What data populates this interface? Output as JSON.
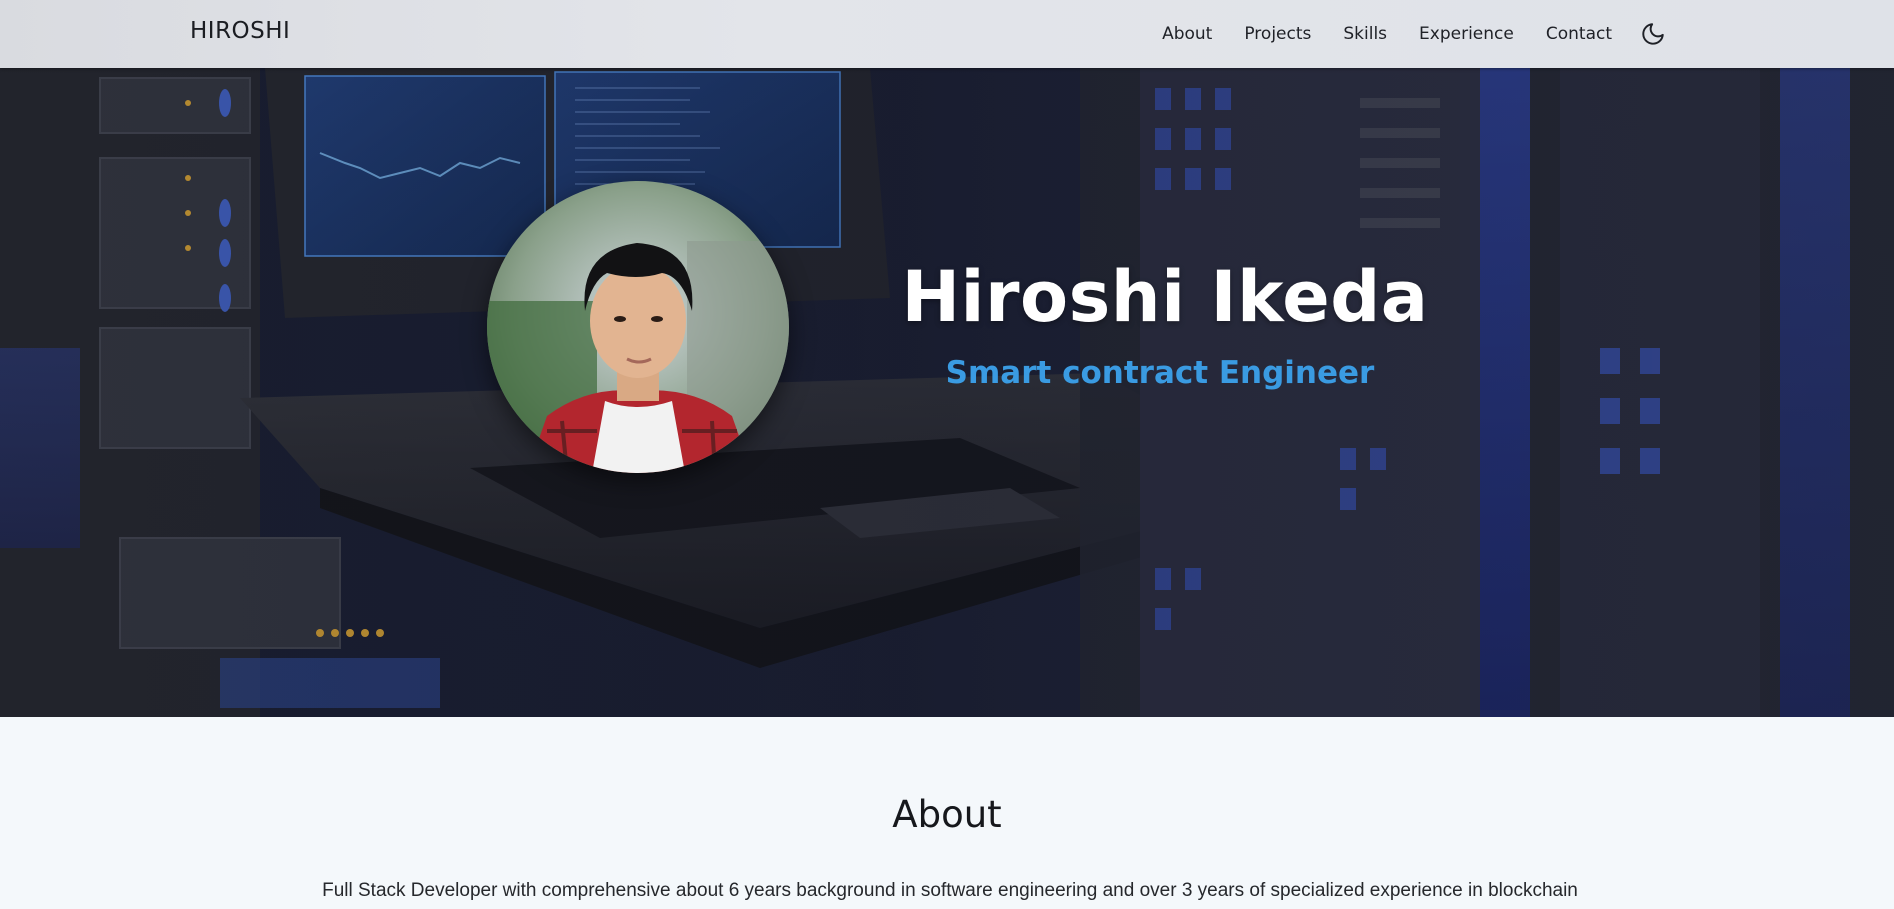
{
  "nav": {
    "brand": "HIROSHI",
    "links": [
      "About",
      "Projects",
      "Skills",
      "Experience",
      "Contact"
    ],
    "theme_toggle_icon": "moon-icon"
  },
  "hero": {
    "name": "Hiroshi Ikeda",
    "role": "Smart contract Engineer",
    "role_color": "#3a9be2",
    "avatar_icon": "profile-photo"
  },
  "about": {
    "title": "About",
    "text": "Full Stack Developer with comprehensive about 6 years background in software engineering and over 3 years of specialized experience in blockchain"
  }
}
